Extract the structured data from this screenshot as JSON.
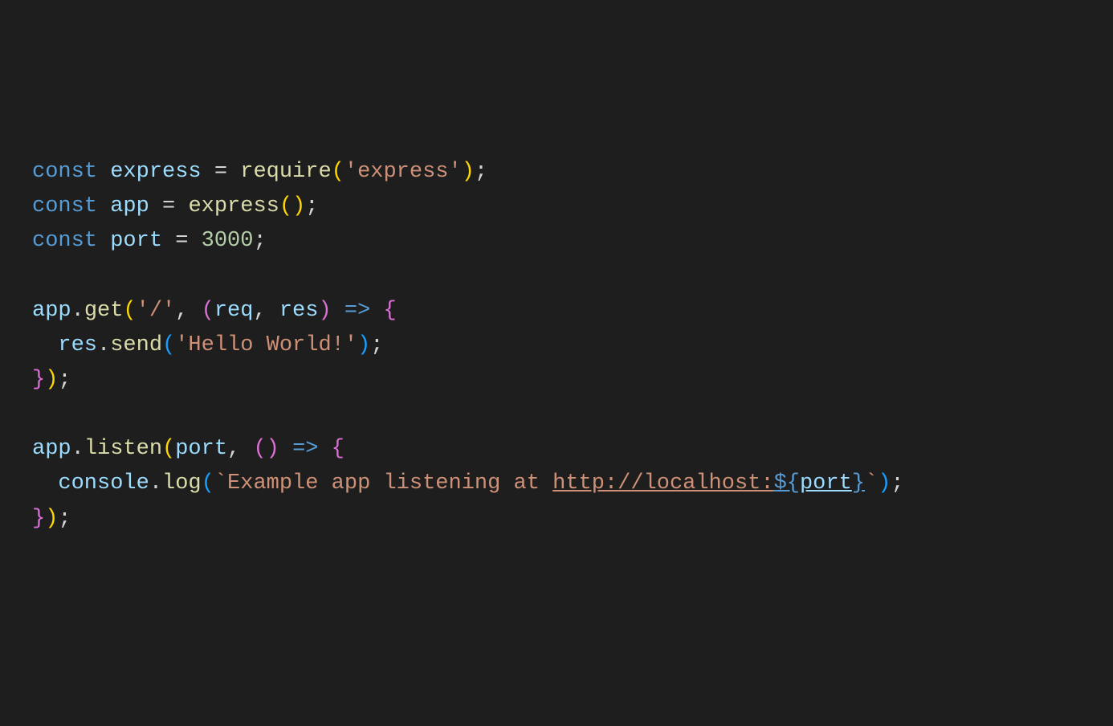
{
  "code": {
    "line1": {
      "const": "const",
      "space1": " ",
      "express": "express",
      "space2": " ",
      "equals": "=",
      "space3": " ",
      "require": "require",
      "openParen": "(",
      "string": "'express'",
      "closeParen": ")",
      "semicolon": ";"
    },
    "line2": {
      "const": "const",
      "space1": " ",
      "app": "app",
      "space2": " ",
      "equals": "=",
      "space3": " ",
      "express": "express",
      "openParen": "(",
      "closeParen": ")",
      "semicolon": ";"
    },
    "line3": {
      "const": "const",
      "space1": " ",
      "port": "port",
      "space2": " ",
      "equals": "=",
      "space3": " ",
      "number": "3000",
      "semicolon": ";"
    },
    "line5": {
      "app": "app",
      "dot": ".",
      "get": "get",
      "openParen": "(",
      "string": "'/'",
      "comma": ",",
      "space1": " ",
      "openParen2": "(",
      "req": "req",
      "comma2": ",",
      "space2": " ",
      "res": "res",
      "closeParen2": ")",
      "space3": " ",
      "arrow": "=>",
      "space4": " ",
      "openBrace": "{"
    },
    "line6": {
      "indent": "  ",
      "res": "res",
      "dot": ".",
      "send": "send",
      "openParen": "(",
      "string": "'Hello World!'",
      "closeParen": ")",
      "semicolon": ";"
    },
    "line7": {
      "closeBrace": "}",
      "closeParen": ")",
      "semicolon": ";"
    },
    "line9": {
      "app": "app",
      "dot": ".",
      "listen": "listen",
      "openParen": "(",
      "portVar": "port",
      "comma": ",",
      "space1": " ",
      "openParen2": "(",
      "closeParen2": ")",
      "space2": " ",
      "arrow": "=>",
      "space3": " ",
      "openBrace": "{"
    },
    "line10": {
      "indent": "  ",
      "console": "console",
      "dot": ".",
      "log": "log",
      "openParen": "(",
      "backtick1": "`",
      "templateText": "Example app listening at ",
      "urlPart": "http://localhost:",
      "dollarBrace": "${",
      "port": "port",
      "closeBrace": "}",
      "backtick2": "`",
      "closeParen": ")",
      "semicolon": ";"
    },
    "line11": {
      "closeBrace": "}",
      "closeParen": ")",
      "semicolon": ";"
    }
  }
}
